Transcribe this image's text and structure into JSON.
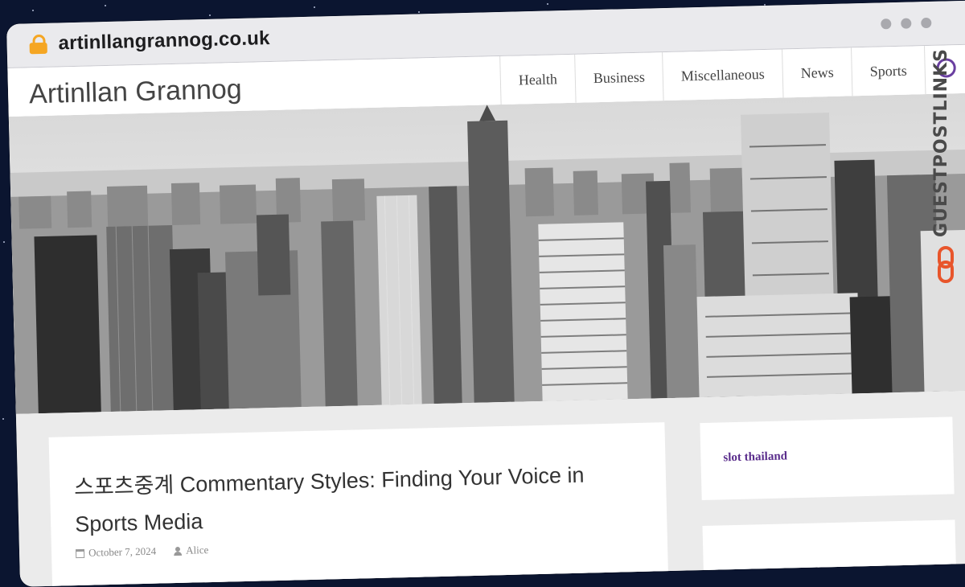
{
  "browser": {
    "url": "artinllangrannog.co.uk"
  },
  "site": {
    "title": "Artinllan Grannog",
    "nav": [
      "Health",
      "Business",
      "Miscellaneous",
      "News",
      "Sports"
    ]
  },
  "post": {
    "title": "스포츠중계 Commentary Styles: Finding Your Voice in Sports Media",
    "date": "October 7, 2024",
    "author": "Alice"
  },
  "sidebar": {
    "link": "slot thailand"
  },
  "watermark": {
    "text": "GUESTPOSTLINKS"
  },
  "colors": {
    "background": "#0b1530",
    "lock": "#f5a623",
    "link": "#5a2d8c",
    "logo_accent": "#e8552b"
  }
}
